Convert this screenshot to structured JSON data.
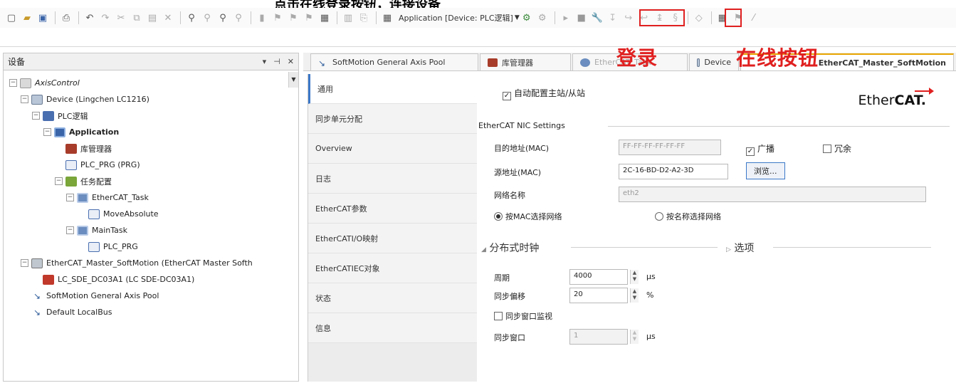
{
  "caption": "点击在线登录按钮，连接设备",
  "toolbar": {
    "app_selector": "Application [Device: PLC逻辑]",
    "accent": "#e02020"
  },
  "annotations": {
    "login": "登录",
    "online": "在线按钮"
  },
  "left_panel": {
    "title": "设备",
    "tree": [
      {
        "label": "AxisControl",
        "level": 0,
        "icon": "project-icon"
      },
      {
        "label": "Device (Lingchen LC1216)",
        "level": 1,
        "icon": "device-icon"
      },
      {
        "label": "PLC逻辑",
        "level": 2,
        "icon": "plc-logic-icon"
      },
      {
        "label": "Application",
        "level": 3,
        "icon": "application-icon"
      },
      {
        "label": "库管理器",
        "level": 4,
        "icon": "library-icon"
      },
      {
        "label": "PLC_PRG (PRG)",
        "level": 4,
        "icon": "program-icon"
      },
      {
        "label": "任务配置",
        "level": 4,
        "icon": "task-config-icon"
      },
      {
        "label": "EtherCAT_Task",
        "level": 5,
        "icon": "task-icon"
      },
      {
        "label": "MoveAbsolute",
        "level": 6,
        "icon": "program-icon"
      },
      {
        "label": "MainTask",
        "level": 5,
        "icon": "task-icon"
      },
      {
        "label": "PLC_PRG",
        "level": 6,
        "icon": "program-icon"
      },
      {
        "label": "EtherCAT_Master_SoftMotion (EtherCAT Master Softh",
        "level": 1,
        "icon": "ethercat-master-icon"
      },
      {
        "label": "LC_SDE_DC03A1 (LC SDE-DC03A1)",
        "level": 2,
        "icon": "slave-icon"
      },
      {
        "label": "SoftMotion General Axis Pool",
        "level": 1,
        "icon": "axis-pool-icon"
      },
      {
        "label": "Default LocalBus",
        "level": 1,
        "icon": "axis-pool-icon"
      }
    ]
  },
  "doc_tabs": [
    {
      "label": "SoftMotion General Axis Pool"
    },
    {
      "label": "库管理器"
    },
    {
      "label": "EtherCAT_Task"
    },
    {
      "label": "Device"
    },
    {
      "label": "EtherCAT_Master_SoftMotion"
    }
  ],
  "vtabs": [
    {
      "label": "通用"
    },
    {
      "label": "同步单元分配"
    },
    {
      "label": "Overview"
    },
    {
      "label": "日志"
    },
    {
      "label": "EtherCAT参数"
    },
    {
      "label": "EtherCATI/O映射"
    },
    {
      "label": "EtherCATIEC对象"
    },
    {
      "label": "状态"
    },
    {
      "label": "信息"
    }
  ],
  "general": {
    "auto_config": "自动配置主站/从站",
    "logo": "EtherCAT.",
    "nic_section": "EtherCAT NIC Settings",
    "dest_label": "目的地址(MAC)",
    "dest_value": "FF-FF-FF-FF-FF-FF",
    "broadcast": "广播",
    "redundant": "冗余",
    "src_label": "源地址(MAC)",
    "src_value": "2C-16-BD-D2-A2-3D",
    "browse_btn": "浏览...",
    "net_name_label": "网络名称",
    "net_name_value": "eth2",
    "by_mac": "按MAC选择网络",
    "by_name": "按名称选择网络",
    "dc_section": "分布式时钟",
    "options_section": "选项",
    "cycle_label": "周期",
    "cycle_value": "4000",
    "cycle_unit": "μs",
    "offset_label": "同步偏移",
    "offset_value": "20",
    "offset_unit": "%",
    "sync_monitor": "同步窗口监视",
    "sync_window_label": "同步窗口",
    "sync_window_value": "1",
    "sync_window_unit": "μs"
  }
}
